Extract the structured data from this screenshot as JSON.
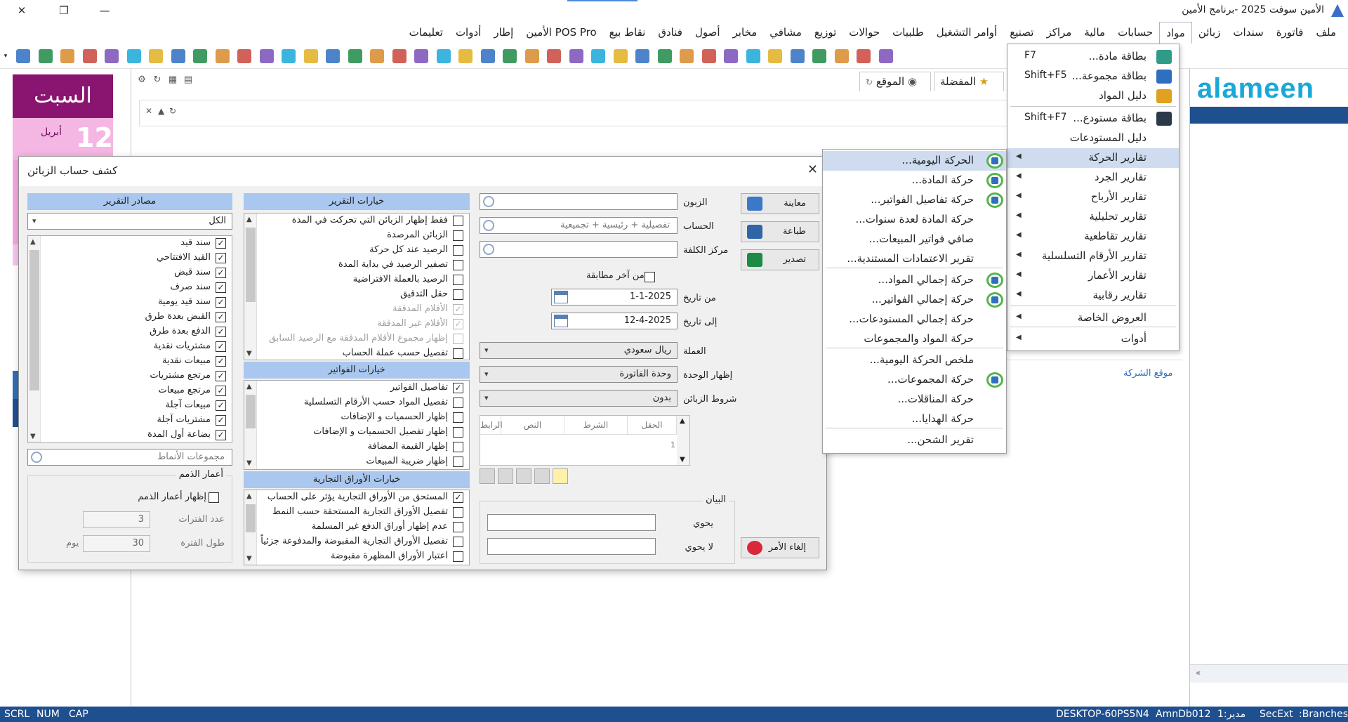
{
  "window": {
    "title": "الأمين سوفت 2025 -برنامج الأمين"
  },
  "menubar": [
    "ملف",
    "فاتورة",
    "سندات",
    "زبائن",
    "مواد",
    "حسابات",
    "مالية",
    "مراكز",
    "تصنيع",
    "أوامر التشغيل",
    "طلبيات",
    "حوالات",
    "توزيع",
    "مشافي",
    "مخابر",
    "أصول",
    "فنادق",
    "نقاط بيع",
    "الأمين POS Pro",
    "إطار",
    "أدوات",
    "تعليمات"
  ],
  "toolbar_icons": [
    "exit-icon",
    "calculator-icon",
    "refresh-icon",
    "folder-icon",
    "folder-icon",
    "export-icon",
    "calendar-heart-icon",
    "user-icon",
    "user-folder-icon",
    "send-icon",
    "shield-icon",
    "shield-user-icon",
    "scissors-icon",
    "card-icon",
    "box-icon",
    "check-icon",
    "truck-icon",
    "transfer-icon",
    "barcode-icon",
    "grid-icon",
    "note-icon",
    "image-icon",
    "document-icon",
    "camera-icon",
    "star-icon",
    "cart-icon",
    "pie-icon",
    "globe-icon",
    "chart-icon",
    "map-icon",
    "pin-icon",
    "check-list-icon",
    "cycle-icon",
    "note-list-icon",
    "users-icon",
    "scale-icon",
    "building-icon",
    "calculator2-icon",
    "document2-icon",
    "door-icon"
  ],
  "calendar": {
    "day": "السبت",
    "date_num": "12",
    "month": "أبريل"
  },
  "tabs": {
    "site": "الموقع",
    "favorites": "المفضلة",
    "partial": "ت"
  },
  "logo": "alameen",
  "company_site": "موقع الشركة",
  "dialog": {
    "title": "كشف حساب الزبائن",
    "sources": {
      "header": "مصادر التقرير",
      "combo": "الكل",
      "items": [
        {
          "label": "سند قيد",
          "checked": true
        },
        {
          "label": "القيد الافتتاحي",
          "checked": true
        },
        {
          "label": "سند قبض",
          "checked": true
        },
        {
          "label": "سند صرف",
          "checked": true
        },
        {
          "label": "سند قيد يومية",
          "checked": true
        },
        {
          "label": "القبض بعدة طرق",
          "checked": true
        },
        {
          "label": "الدفع بعدة طرق",
          "checked": true
        },
        {
          "label": "مشتريات نقدية",
          "checked": true
        },
        {
          "label": "مبيعات نقدية",
          "checked": true
        },
        {
          "label": "مرتجع مشتريات",
          "checked": true
        },
        {
          "label": "مرتجع مبيعات",
          "checked": true
        },
        {
          "label": "مبيعات آجلة",
          "checked": true
        },
        {
          "label": "مشتريات آجلة",
          "checked": true
        },
        {
          "label": "بضاعة أول المدة",
          "checked": true
        }
      ],
      "pattern_placeholder": "مجموعات الأنماط",
      "aging": {
        "title": "أعمار الذمم",
        "show_label": "إظهار أعمار الذمم",
        "periods_label": "عدد الفترات",
        "periods_value": "3",
        "length_label": "طول الفترة",
        "length_value": "30",
        "unit": "يوم"
      }
    },
    "report_options": {
      "header": "خيارات التقرير",
      "items": [
        {
          "label": "فقط إظهار الزبائن التي تحركت في المدة",
          "checked": false,
          "disabled": false
        },
        {
          "label": "الزبائن المرصدة",
          "checked": false,
          "disabled": false
        },
        {
          "label": "الرصيد عند كل حركة",
          "checked": false,
          "disabled": false
        },
        {
          "label": "تصفير الرصيد في بداية المدة",
          "checked": false,
          "disabled": false
        },
        {
          "label": "الرصيد بالعملة الافتراضية",
          "checked": false,
          "disabled": false
        },
        {
          "label": "حقل التدقيق",
          "checked": false,
          "disabled": false
        },
        {
          "label": "الأقلام المدققة",
          "checked": true,
          "disabled": true
        },
        {
          "label": "الأقلام غير المدققة",
          "checked": true,
          "disabled": true
        },
        {
          "label": "إظهار مجموع الأقلام المدققة مع الرصيد السابق",
          "checked": false,
          "disabled": true
        },
        {
          "label": "تفصيل حسب عملة الحساب",
          "checked": false,
          "disabled": false
        }
      ]
    },
    "invoice_options": {
      "header": "خيارات الفواتير",
      "items": [
        {
          "label": "تفاصيل الفواتير",
          "checked": true
        },
        {
          "label": "تفصيل المواد حسب الأرقام التسلسلية",
          "checked": false
        },
        {
          "label": "إظهار الحسميات و الإضافات",
          "checked": false
        },
        {
          "label": "إظهار تفصيل الحسميات و الإضافات",
          "checked": false
        },
        {
          "label": "إظهار القيمة المضافة",
          "checked": false
        },
        {
          "label": "إظهار ضريبة المبيعات",
          "checked": false
        }
      ]
    },
    "paper_options": {
      "header": "خيارات الأوراق التجارية",
      "items": [
        {
          "label": "المستحق من الأوراق التجارية يؤثر على الحساب",
          "checked": true
        },
        {
          "label": "تفصيل الأوراق التجارية المستحقة حسب النمط",
          "checked": false
        },
        {
          "label": "عدم إظهار أوراق الدفع غير المسلمة",
          "checked": false
        },
        {
          "label": "تفصيل الأوراق التجارية المقبوضة والمدفوعة جزئياً",
          "checked": false
        },
        {
          "label": "اعتبار الأوراق المظهرة مقبوضة",
          "checked": false
        }
      ]
    },
    "filters": {
      "customer_label": "الزبون",
      "account_label": "الحساب",
      "account_placeholder": "تفصيلية + رئيسية + تجميعية",
      "cost_center_label": "مركز الكلفة",
      "last_match_label": "من آخر مطابقة",
      "from_label": "من تاريخ",
      "from_value": "1-1-2025",
      "to_label": "إلى تاريخ",
      "to_value": "12-4-2025",
      "currency_label": "العملة",
      "currency_value": "ريال سعودي",
      "unit_label": "إظهار الوحدة",
      "unit_value": "وحدة الفاتورة",
      "cond_label": "شروط الزبائن",
      "cond_value": "بدون",
      "grid_cols": [
        "الحقل",
        "الشرط",
        "النص",
        "الرابط"
      ],
      "grid_row": "1",
      "statement_label": "البيان",
      "contains_label": "يحوي",
      "not_contains_label": "لا يحوي"
    },
    "buttons": {
      "preview": "معاينة",
      "print": "طباعة",
      "export": "تصدير",
      "cancel": "إلغاء الأمر"
    }
  },
  "materials_menu": [
    {
      "label": "بطاقة مادة...",
      "key": "F7",
      "icon": "material-card-icon"
    },
    {
      "label": "بطاقة مجموعة...",
      "key": "Shift+F5",
      "icon": "group-card-icon"
    },
    {
      "label": "دليل المواد",
      "key": "",
      "icon": "folder-icon"
    },
    {
      "label": "بطاقة مستودع...",
      "key": "Shift+F7",
      "icon": "warehouse-icon"
    },
    {
      "label": "دليل المستودعات",
      "key": "",
      "icon": ""
    },
    {
      "label": "تقارير الحركة",
      "sub": true
    },
    {
      "label": "تقارير الجرد",
      "sub": true
    },
    {
      "label": "تقارير الأرباح",
      "sub": true
    },
    {
      "label": "تقارير تحليلية",
      "sub": true
    },
    {
      "label": "تقارير تقاطعية",
      "sub": true
    },
    {
      "label": "تقارير الأرقام التسلسلية",
      "sub": true
    },
    {
      "label": "تقارير الأعمار",
      "sub": true
    },
    {
      "label": "تقارير رقابية",
      "sub": true
    },
    {
      "label": "العروض الخاصة",
      "sub": true
    },
    {
      "label": "أدوات",
      "sub": true
    }
  ],
  "movement_menu": [
    {
      "label": "الحركة اليومية...",
      "icon": true
    },
    {
      "label": "حركة المادة...",
      "icon": true
    },
    {
      "label": "حركة تفاصيل الفواتير...",
      "icon": true
    },
    {
      "label": "حركة المادة لعدة سنوات...",
      "icon": false
    },
    {
      "label": "صافي فواتير المبيعات...",
      "icon": false
    },
    {
      "label": "تقرير الاعتمادات المستندية...",
      "icon": false
    },
    {
      "label": "حركة  إجمالي المواد...",
      "icon": true
    },
    {
      "label": "حركة  إجمالي الفواتير...",
      "icon": true
    },
    {
      "label": "حركة إجمالي المستودعات...",
      "icon": false
    },
    {
      "label": "حركة المواد والمجموعات",
      "icon": false
    },
    {
      "label": "ملخص الحركة اليومية...",
      "icon": false
    },
    {
      "label": "حركة المجموعات...",
      "icon": true
    },
    {
      "label": "حركة المناقلات...",
      "icon": false
    },
    {
      "label": "حركة الهدايا...",
      "icon": false
    },
    {
      "label": "تقرير الشحن...",
      "icon": false
    }
  ],
  "status": {
    "scrl": "SCRL",
    "num": "NUM",
    "cap": "CAP",
    "machine": "DESKTOP-60PS5N4",
    "db": "AmnDb012",
    "user": "1:مدير",
    "secext": "SecExt",
    "branches": ":Branches"
  },
  "colors": {
    "accent": "#1e4f8f",
    "section": "#a9c7ef",
    "calendar": "#8a1570",
    "logo": "#1aa8d8"
  }
}
